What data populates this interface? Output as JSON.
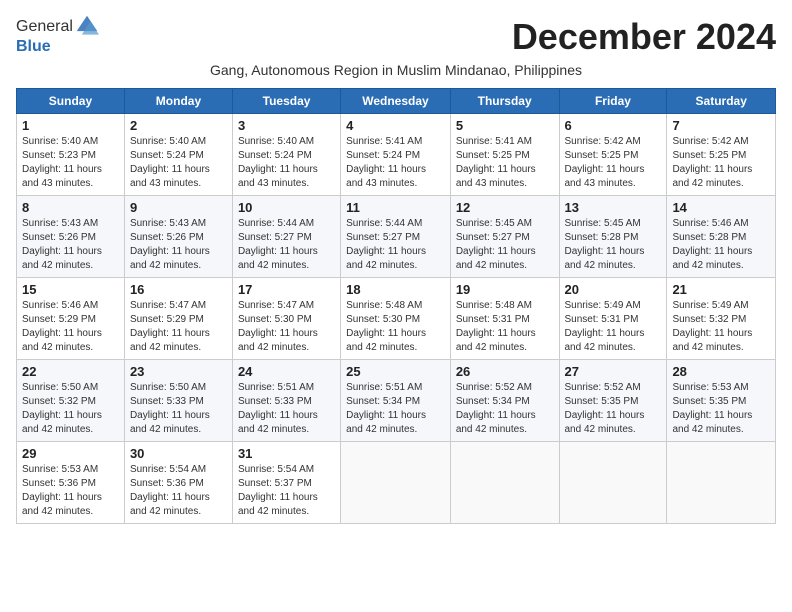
{
  "logo": {
    "general": "General",
    "blue": "Blue"
  },
  "title": "December 2024",
  "subtitle": "Gang, Autonomous Region in Muslim Mindanao, Philippines",
  "weekdays": [
    "Sunday",
    "Monday",
    "Tuesday",
    "Wednesday",
    "Thursday",
    "Friday",
    "Saturday"
  ],
  "weeks": [
    [
      {
        "day": "1",
        "sunrise": "5:40 AM",
        "sunset": "5:23 PM",
        "daylight": "11 hours and 43 minutes."
      },
      {
        "day": "2",
        "sunrise": "5:40 AM",
        "sunset": "5:24 PM",
        "daylight": "11 hours and 43 minutes."
      },
      {
        "day": "3",
        "sunrise": "5:40 AM",
        "sunset": "5:24 PM",
        "daylight": "11 hours and 43 minutes."
      },
      {
        "day": "4",
        "sunrise": "5:41 AM",
        "sunset": "5:24 PM",
        "daylight": "11 hours and 43 minutes."
      },
      {
        "day": "5",
        "sunrise": "5:41 AM",
        "sunset": "5:25 PM",
        "daylight": "11 hours and 43 minutes."
      },
      {
        "day": "6",
        "sunrise": "5:42 AM",
        "sunset": "5:25 PM",
        "daylight": "11 hours and 43 minutes."
      },
      {
        "day": "7",
        "sunrise": "5:42 AM",
        "sunset": "5:25 PM",
        "daylight": "11 hours and 42 minutes."
      }
    ],
    [
      {
        "day": "8",
        "sunrise": "5:43 AM",
        "sunset": "5:26 PM",
        "daylight": "11 hours and 42 minutes."
      },
      {
        "day": "9",
        "sunrise": "5:43 AM",
        "sunset": "5:26 PM",
        "daylight": "11 hours and 42 minutes."
      },
      {
        "day": "10",
        "sunrise": "5:44 AM",
        "sunset": "5:27 PM",
        "daylight": "11 hours and 42 minutes."
      },
      {
        "day": "11",
        "sunrise": "5:44 AM",
        "sunset": "5:27 PM",
        "daylight": "11 hours and 42 minutes."
      },
      {
        "day": "12",
        "sunrise": "5:45 AM",
        "sunset": "5:27 PM",
        "daylight": "11 hours and 42 minutes."
      },
      {
        "day": "13",
        "sunrise": "5:45 AM",
        "sunset": "5:28 PM",
        "daylight": "11 hours and 42 minutes."
      },
      {
        "day": "14",
        "sunrise": "5:46 AM",
        "sunset": "5:28 PM",
        "daylight": "11 hours and 42 minutes."
      }
    ],
    [
      {
        "day": "15",
        "sunrise": "5:46 AM",
        "sunset": "5:29 PM",
        "daylight": "11 hours and 42 minutes."
      },
      {
        "day": "16",
        "sunrise": "5:47 AM",
        "sunset": "5:29 PM",
        "daylight": "11 hours and 42 minutes."
      },
      {
        "day": "17",
        "sunrise": "5:47 AM",
        "sunset": "5:30 PM",
        "daylight": "11 hours and 42 minutes."
      },
      {
        "day": "18",
        "sunrise": "5:48 AM",
        "sunset": "5:30 PM",
        "daylight": "11 hours and 42 minutes."
      },
      {
        "day": "19",
        "sunrise": "5:48 AM",
        "sunset": "5:31 PM",
        "daylight": "11 hours and 42 minutes."
      },
      {
        "day": "20",
        "sunrise": "5:49 AM",
        "sunset": "5:31 PM",
        "daylight": "11 hours and 42 minutes."
      },
      {
        "day": "21",
        "sunrise": "5:49 AM",
        "sunset": "5:32 PM",
        "daylight": "11 hours and 42 minutes."
      }
    ],
    [
      {
        "day": "22",
        "sunrise": "5:50 AM",
        "sunset": "5:32 PM",
        "daylight": "11 hours and 42 minutes."
      },
      {
        "day": "23",
        "sunrise": "5:50 AM",
        "sunset": "5:33 PM",
        "daylight": "11 hours and 42 minutes."
      },
      {
        "day": "24",
        "sunrise": "5:51 AM",
        "sunset": "5:33 PM",
        "daylight": "11 hours and 42 minutes."
      },
      {
        "day": "25",
        "sunrise": "5:51 AM",
        "sunset": "5:34 PM",
        "daylight": "11 hours and 42 minutes."
      },
      {
        "day": "26",
        "sunrise": "5:52 AM",
        "sunset": "5:34 PM",
        "daylight": "11 hours and 42 minutes."
      },
      {
        "day": "27",
        "sunrise": "5:52 AM",
        "sunset": "5:35 PM",
        "daylight": "11 hours and 42 minutes."
      },
      {
        "day": "28",
        "sunrise": "5:53 AM",
        "sunset": "5:35 PM",
        "daylight": "11 hours and 42 minutes."
      }
    ],
    [
      {
        "day": "29",
        "sunrise": "5:53 AM",
        "sunset": "5:36 PM",
        "daylight": "11 hours and 42 minutes."
      },
      {
        "day": "30",
        "sunrise": "5:54 AM",
        "sunset": "5:36 PM",
        "daylight": "11 hours and 42 minutes."
      },
      {
        "day": "31",
        "sunrise": "5:54 AM",
        "sunset": "5:37 PM",
        "daylight": "11 hours and 42 minutes."
      },
      null,
      null,
      null,
      null
    ]
  ]
}
